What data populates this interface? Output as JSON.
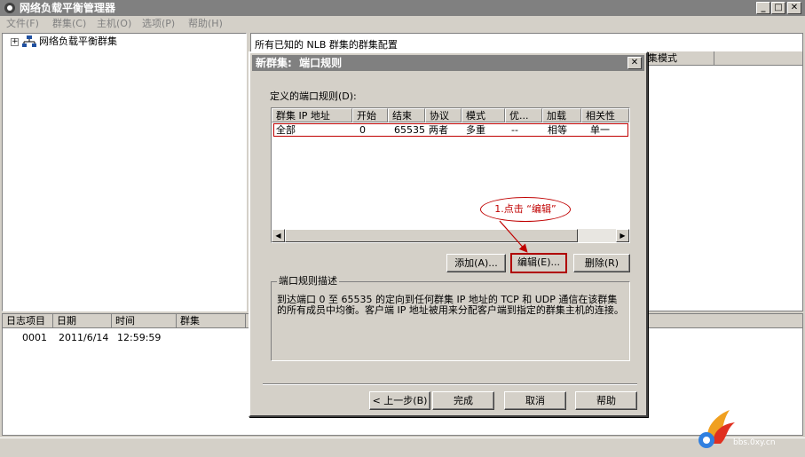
{
  "window": {
    "title": "网络负载平衡管理器"
  },
  "menu": [
    "文件(F)",
    "群集(C)",
    "主机(O)",
    "选项(P)",
    "帮助(H)"
  ],
  "tree": {
    "root": "网络负载平衡群集"
  },
  "right_panel": {
    "header": "所有已知的 NLB 群集的群集配置",
    "visible_column": "集模式"
  },
  "log": {
    "columns": [
      "日志项目",
      "日期",
      "时间",
      "群集"
    ],
    "rows": [
      {
        "item": "0001",
        "date": "2011/6/14",
        "time": "12:59:59"
      }
    ]
  },
  "dialog": {
    "title": "新群集:  端口规则",
    "rules_label": "定义的端口规则(D):",
    "columns": [
      "群集 IP 地址",
      "开始",
      "结束",
      "协议",
      "模式",
      "优...",
      "加载",
      "相关性"
    ],
    "rows": [
      {
        "ip": "全部",
        "start": "0",
        "end": "65535",
        "protocol": "两者",
        "mode": "多重",
        "priority": "--",
        "load": "相等",
        "affinity": "单一"
      }
    ],
    "add_button": "添加(A)...",
    "edit_button": "编辑(E)...",
    "remove_button": "删除(R)",
    "desc_title": "端口规则描述",
    "desc_text": "到达端口 0 至 65535 的定向到任何群集 IP 地址的 TCP 和 UDP 通信在该群集的所有成员中均衡。客户端 IP 地址被用来分配客户端到指定的群集主机的连接。",
    "back_button": "< 上一步(B)",
    "finish_button": "完成",
    "cancel_button": "取消",
    "help_button": "帮助"
  },
  "annotation": {
    "callout": "1.点击 “编辑”"
  },
  "watermark": {
    "text": "bbs.0xy.cn"
  },
  "colors": {
    "annotation": "#c00000",
    "title_bar": "#808080",
    "face": "#d4d0c8"
  }
}
